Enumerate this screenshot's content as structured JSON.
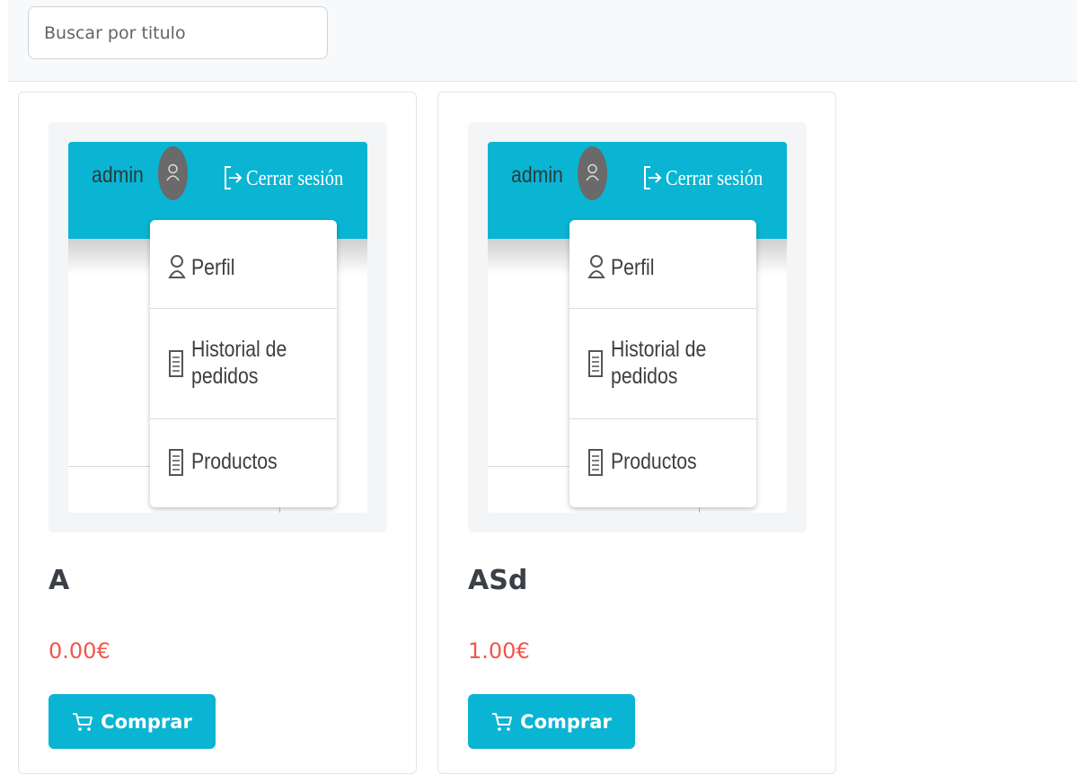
{
  "search": {
    "placeholder": "Buscar por titulo"
  },
  "preview": {
    "user": "admin",
    "logout": "Cerrar sesión",
    "menu": [
      {
        "label": "Perfil",
        "icon": "user-icon"
      },
      {
        "label": "Historial de pedidos",
        "label_lines": [
          "Historial de",
          "pedidos"
        ],
        "icon": "receipt-icon"
      },
      {
        "label": "Productos",
        "icon": "receipt-icon"
      }
    ]
  },
  "products": [
    {
      "title": "A",
      "price": "0.00€",
      "buy_label": "Comprar"
    },
    {
      "title": "ASd",
      "price": "1.00€",
      "buy_label": "Comprar"
    }
  ],
  "colors": {
    "accent": "#0ab5d3",
    "price": "#f2564a",
    "title": "#3a4047"
  }
}
